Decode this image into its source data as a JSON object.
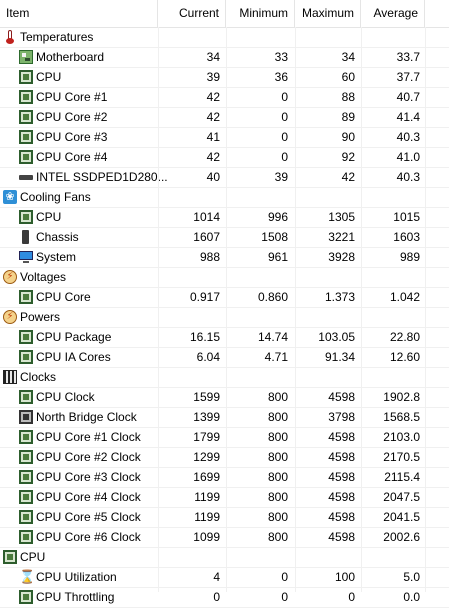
{
  "header": {
    "item": "Item",
    "current": "Current",
    "minimum": "Minimum",
    "maximum": "Maximum",
    "average": "Average"
  },
  "rows": [
    {
      "kind": "group",
      "icon": "thermometer-icon",
      "label": "Temperatures"
    },
    {
      "kind": "child",
      "icon": "motherboard-icon",
      "label": "Motherboard",
      "current": "34",
      "min": "33",
      "max": "34",
      "avg": "33.7"
    },
    {
      "kind": "child",
      "icon": "chip-icon",
      "label": "CPU",
      "current": "39",
      "min": "36",
      "max": "60",
      "avg": "37.7"
    },
    {
      "kind": "child",
      "icon": "chip-icon",
      "label": "CPU Core #1",
      "current": "42",
      "min": "0",
      "max": "88",
      "avg": "40.7"
    },
    {
      "kind": "child",
      "icon": "chip-icon",
      "label": "CPU Core #2",
      "current": "42",
      "min": "0",
      "max": "89",
      "avg": "41.4"
    },
    {
      "kind": "child",
      "icon": "chip-icon",
      "label": "CPU Core #3",
      "current": "41",
      "min": "0",
      "max": "90",
      "avg": "40.3"
    },
    {
      "kind": "child",
      "icon": "chip-icon",
      "label": "CPU Core #4",
      "current": "42",
      "min": "0",
      "max": "92",
      "avg": "41.0"
    },
    {
      "kind": "child",
      "icon": "ssd-icon",
      "label": "INTEL SSDPED1D280...",
      "current": "40",
      "min": "39",
      "max": "42",
      "avg": "40.3"
    },
    {
      "kind": "group",
      "icon": "fan-icon",
      "label": "Cooling Fans"
    },
    {
      "kind": "child",
      "icon": "chip-icon",
      "label": "CPU",
      "current": "1014",
      "min": "996",
      "max": "1305",
      "avg": "1015"
    },
    {
      "kind": "child",
      "icon": "chassis-icon",
      "label": "Chassis",
      "current": "1607",
      "min": "1508",
      "max": "3221",
      "avg": "1603"
    },
    {
      "kind": "child",
      "icon": "monitor-icon",
      "label": "System",
      "current": "988",
      "min": "961",
      "max": "3928",
      "avg": "989"
    },
    {
      "kind": "group",
      "icon": "voltage-icon",
      "label": "Voltages"
    },
    {
      "kind": "child",
      "icon": "chip-icon",
      "label": "CPU Core",
      "current": "0.917",
      "min": "0.860",
      "max": "1.373",
      "avg": "1.042"
    },
    {
      "kind": "group",
      "icon": "power-icon",
      "label": "Powers"
    },
    {
      "kind": "child",
      "icon": "chip-icon",
      "label": "CPU Package",
      "current": "16.15",
      "min": "14.74",
      "max": "103.05",
      "avg": "22.80"
    },
    {
      "kind": "child",
      "icon": "chip-icon",
      "label": "CPU IA Cores",
      "current": "6.04",
      "min": "4.71",
      "max": "91.34",
      "avg": "12.60"
    },
    {
      "kind": "group",
      "icon": "clocks-icon",
      "label": "Clocks"
    },
    {
      "kind": "child",
      "icon": "chip-icon",
      "label": "CPU Clock",
      "current": "1599",
      "min": "800",
      "max": "4598",
      "avg": "1902.8"
    },
    {
      "kind": "child",
      "icon": "northbridge-icon",
      "label": "North Bridge Clock",
      "current": "1399",
      "min": "800",
      "max": "3798",
      "avg": "1568.5"
    },
    {
      "kind": "child",
      "icon": "chip-icon",
      "label": "CPU Core #1 Clock",
      "current": "1799",
      "min": "800",
      "max": "4598",
      "avg": "2103.0"
    },
    {
      "kind": "child",
      "icon": "chip-icon",
      "label": "CPU Core #2 Clock",
      "current": "1299",
      "min": "800",
      "max": "4598",
      "avg": "2170.5"
    },
    {
      "kind": "child",
      "icon": "chip-icon",
      "label": "CPU Core #3 Clock",
      "current": "1699",
      "min": "800",
      "max": "4598",
      "avg": "2115.4"
    },
    {
      "kind": "child",
      "icon": "chip-icon",
      "label": "CPU Core #4 Clock",
      "current": "1199",
      "min": "800",
      "max": "4598",
      "avg": "2047.5"
    },
    {
      "kind": "child",
      "icon": "chip-icon",
      "label": "CPU Core #5 Clock",
      "current": "1199",
      "min": "800",
      "max": "4598",
      "avg": "2041.5"
    },
    {
      "kind": "child",
      "icon": "chip-icon",
      "label": "CPU Core #6 Clock",
      "current": "1099",
      "min": "800",
      "max": "4598",
      "avg": "2002.6"
    },
    {
      "kind": "group",
      "icon": "cpu-icon",
      "label": "CPU"
    },
    {
      "kind": "child",
      "icon": "hourglass-icon",
      "label": "CPU Utilization",
      "current": "4",
      "min": "0",
      "max": "100",
      "avg": "5.0"
    },
    {
      "kind": "child",
      "icon": "chip-icon",
      "label": "CPU Throttling",
      "current": "0",
      "min": "0",
      "max": "0",
      "avg": "0.0"
    }
  ]
}
